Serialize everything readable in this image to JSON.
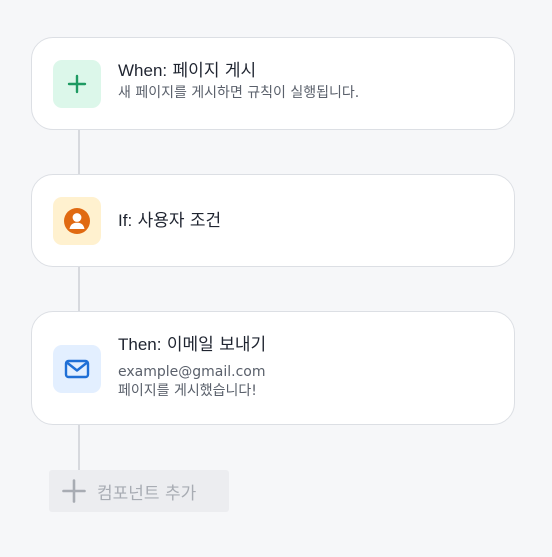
{
  "steps": [
    {
      "keyword": "When:",
      "title": "페이지 게시",
      "description": "새 페이지를 게시하면 규칙이 실행됩니다.",
      "icon": "plus-icon",
      "icon_color": "#1e9a62",
      "icon_bg": "#dcf7ea"
    },
    {
      "keyword": "If:",
      "title": "사용자 조건",
      "icon": "user-icon",
      "icon_color": "#e06a12",
      "icon_bg": "#fff1cf"
    },
    {
      "keyword": "Then:",
      "title": "이메일 보내기",
      "detail_email": "example@gmail.com",
      "detail_message": "페이지를 게시했습니다!",
      "icon": "mail-icon",
      "icon_color": "#1f6fd6",
      "icon_bg": "#e3efff"
    }
  ],
  "add_component": {
    "label": "컴포넌트 추가",
    "icon": "plus-icon"
  },
  "colors": {
    "background": "#f6f7f9",
    "card_border": "#dcdfe4",
    "connector": "#d7d9de"
  }
}
